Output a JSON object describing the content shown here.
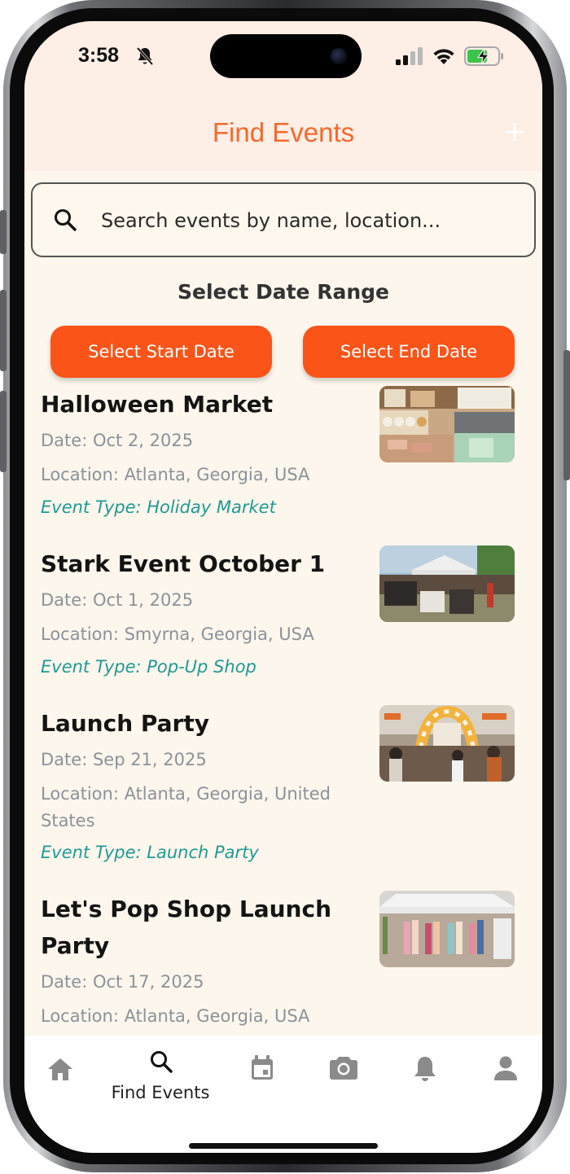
{
  "status_bar": {
    "time": "3:58"
  },
  "header": {
    "title": "Find Events"
  },
  "search": {
    "placeholder": "Search events by name, location..."
  },
  "date_range": {
    "title": "Select Date Range",
    "start_label": "Select Start Date",
    "end_label": "Select End Date"
  },
  "events": [
    {
      "title": "Halloween Market",
      "date": "Date: Oct 2, 2025",
      "location": "Location: Atlanta, Georgia, USA",
      "type": "Event Type: Holiday Market"
    },
    {
      "title": "Stark Event October 1",
      "date": "Date: Oct 1, 2025",
      "location": "Location: Smyrna, Georgia, USA",
      "type": "Event Type: Pop-Up Shop"
    },
    {
      "title": "Launch Party",
      "date": "Date: Sep 21, 2025",
      "location": "Location: Atlanta, Georgia, United States",
      "type": "Event Type: Launch Party"
    },
    {
      "title": "Let's Pop Shop Launch Party",
      "date": "Date: Oct 17, 2025",
      "location": "Location: Atlanta, Georgia, USA",
      "type": ""
    }
  ],
  "bottom_nav": {
    "active_label": "Find Events",
    "items": [
      "home-icon",
      "search-icon",
      "calendar-icon",
      "camera-icon",
      "bell-icon",
      "person-icon"
    ]
  },
  "colors": {
    "accent": "#f4692a",
    "button": "#fa5418",
    "event_type": "#1f9a94",
    "background": "#fdf6ec",
    "header_bg": "#fdeee6"
  }
}
